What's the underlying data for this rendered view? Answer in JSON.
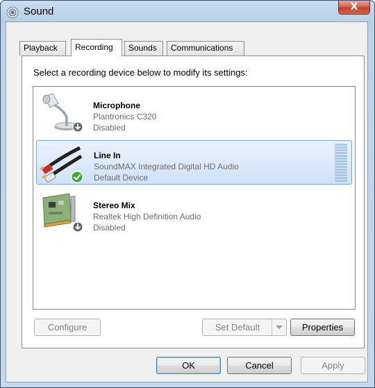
{
  "window": {
    "title": "Sound",
    "close_label": "X"
  },
  "tabs": [
    {
      "label": "Playback",
      "active": false
    },
    {
      "label": "Recording",
      "active": true
    },
    {
      "label": "Sounds",
      "active": false
    },
    {
      "label": "Communications",
      "active": false
    }
  ],
  "recording": {
    "instruction": "Select a recording device below to modify its settings:",
    "devices": [
      {
        "name": "Microphone",
        "description": "Plantronics C320",
        "status": "Disabled",
        "icon": "microphone-icon",
        "badge": "disabled-arrow-icon",
        "selected": false
      },
      {
        "name": "Line In",
        "description": "SoundMAX Integrated Digital HD Audio",
        "status": "Default Device",
        "icon": "line-in-cable-icon",
        "badge": "default-checkmark-icon",
        "selected": true
      },
      {
        "name": "Stereo Mix",
        "description": "Realtek High Definition Audio",
        "status": "Disabled",
        "icon": "sound-card-icon",
        "badge": "disabled-arrow-icon",
        "selected": false
      }
    ],
    "buttons": {
      "configure": "Configure",
      "set_default": "Set Default",
      "properties": "Properties"
    }
  },
  "footer": {
    "ok": "OK",
    "cancel": "Cancel",
    "apply": "Apply"
  },
  "colors": {
    "selection_fill": "#cfe2f8",
    "selection_border": "#7da2ce",
    "checkmark_green": "#3aa83a",
    "close_red": "#c8452e"
  }
}
